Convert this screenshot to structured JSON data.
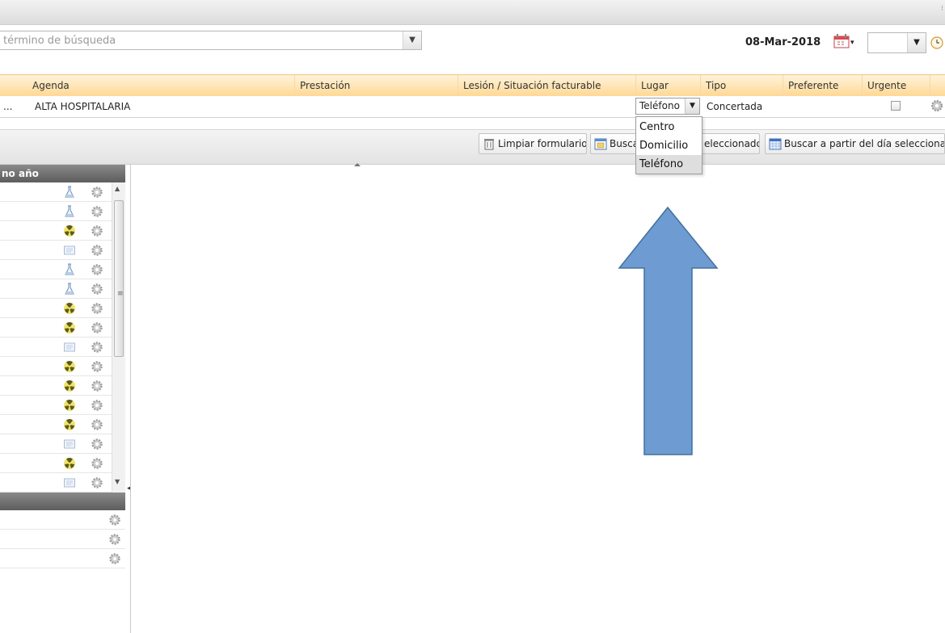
{
  "search": {
    "placeholder": "término de búsqueda"
  },
  "date": {
    "label": "08-Mar-2018"
  },
  "grid": {
    "columns": [
      "Agenda",
      "Prestación",
      "Lesión / Situación facturable",
      "Lugar",
      "Tipo",
      "Preferente",
      "Urgente"
    ],
    "row": {
      "prefix": "...",
      "agenda": "ALTA HOSPITALARIA",
      "lugar": "Teléfono",
      "tipo": "Concertada",
      "urgente_checked": false
    }
  },
  "lugar_dropdown": {
    "options": [
      "Centro",
      "Domicilio",
      "Teléfono"
    ],
    "selected": "Teléfono"
  },
  "toolbar": {
    "clear_label": "Limpiar formulario",
    "search_partial_label": "Busca",
    "search_selected_partial": "eleccionado",
    "search_from_day_label": "Buscar a partir del día seleccionado"
  },
  "left_panel": {
    "header": "no año",
    "rows": [
      "flask",
      "flask",
      "radiation",
      "doc",
      "flask",
      "flask",
      "radiation",
      "radiation",
      "doc",
      "radiation",
      "radiation",
      "radiation",
      "radiation",
      "doc",
      "radiation",
      "doc"
    ],
    "lower_rows": 3
  },
  "colors": {
    "grid_header": "#ffd995",
    "arrow_fill": "#6e9bd1",
    "arrow_stroke": "#41719c"
  }
}
